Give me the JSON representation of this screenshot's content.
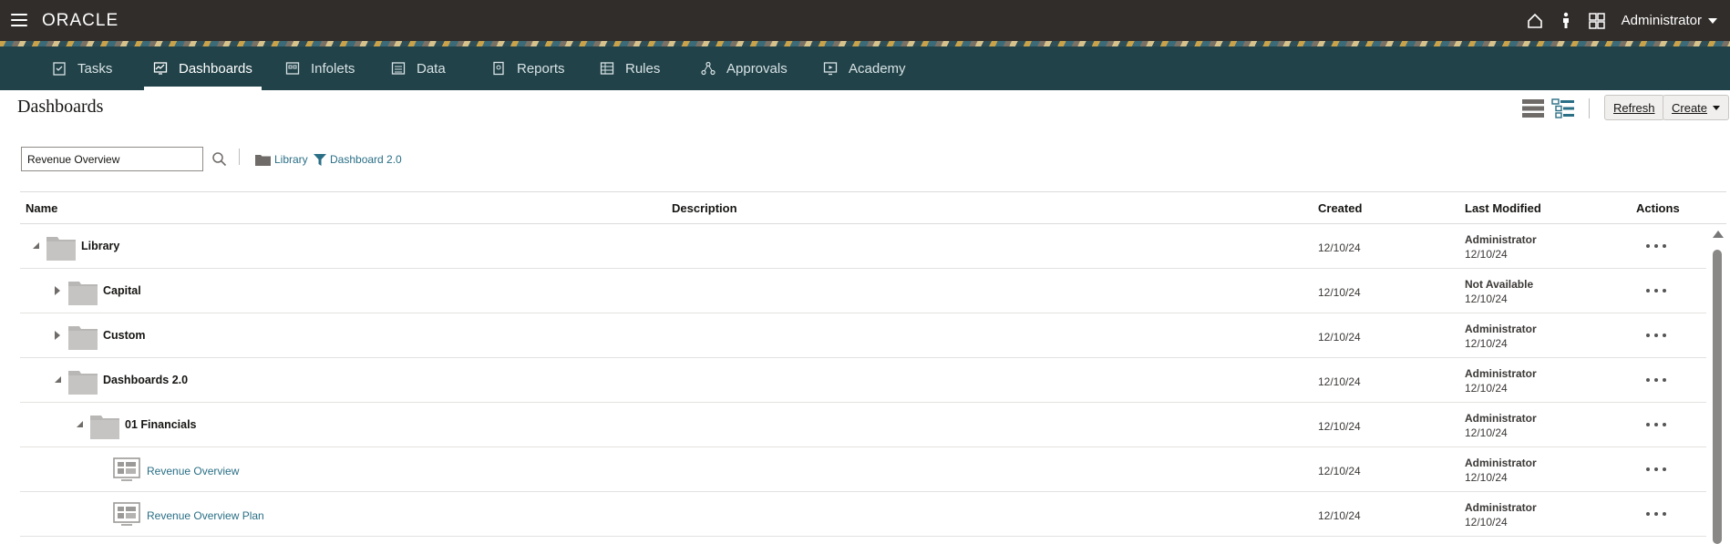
{
  "topbar": {
    "brand": "ORACLE",
    "user_label": "Administrator",
    "icons": [
      "home-icon",
      "accessibility-icon",
      "app-grid-icon"
    ]
  },
  "nav": {
    "items": [
      {
        "label": "Tasks",
        "icon": "tasks-icon",
        "active": false
      },
      {
        "label": "Dashboards",
        "icon": "dashboards-icon",
        "active": true
      },
      {
        "label": "Infolets",
        "icon": "infolets-icon",
        "active": false
      },
      {
        "label": "Data",
        "icon": "data-icon",
        "active": false
      },
      {
        "label": "Reports",
        "icon": "reports-icon",
        "active": false
      },
      {
        "label": "Rules",
        "icon": "rules-icon",
        "active": false
      },
      {
        "label": "Approvals",
        "icon": "approvals-icon",
        "active": false
      },
      {
        "label": "Academy",
        "icon": "academy-icon",
        "active": false
      }
    ]
  },
  "page": {
    "title": "Dashboards",
    "refresh_label": "Refresh",
    "create_label": "Create"
  },
  "filter": {
    "search_value": "Revenue Overview",
    "crumbs": [
      {
        "label": "Library",
        "icon": "folder-icon"
      },
      {
        "label": "Dashboard 2.0",
        "icon": "filter-icon"
      }
    ]
  },
  "table": {
    "columns": [
      "Name",
      "Description",
      "Created",
      "Last Modified",
      "Actions"
    ],
    "rows": [
      {
        "name": "Library",
        "type": "folder",
        "level": 0,
        "expanded": true,
        "created": "12/10/24",
        "modified_by": "Administrator",
        "modified_date": "12/10/24"
      },
      {
        "name": "Capital",
        "type": "folder",
        "level": 1,
        "expanded": false,
        "created": "12/10/24",
        "modified_by": "Not Available",
        "modified_date": "12/10/24"
      },
      {
        "name": "Custom",
        "type": "folder",
        "level": 1,
        "expanded": false,
        "created": "12/10/24",
        "modified_by": "Administrator",
        "modified_date": "12/10/24"
      },
      {
        "name": "Dashboards 2.0",
        "type": "folder",
        "level": 1,
        "expanded": true,
        "created": "12/10/24",
        "modified_by": "Administrator",
        "modified_date": "12/10/24"
      },
      {
        "name": "01 Financials",
        "type": "folder",
        "level": 2,
        "expanded": true,
        "created": "12/10/24",
        "modified_by": "Administrator",
        "modified_date": "12/10/24"
      },
      {
        "name": "Revenue Overview",
        "type": "dashboard",
        "level": 3,
        "created": "12/10/24",
        "modified_by": "Administrator",
        "modified_date": "12/10/24"
      },
      {
        "name": "Revenue Overview Plan",
        "type": "dashboard",
        "level": 3,
        "created": "12/10/24",
        "modified_by": "Administrator",
        "modified_date": "12/10/24"
      }
    ]
  },
  "colors": {
    "topbar": "#312d2a",
    "navbar": "#214248",
    "link": "#2a6f86"
  }
}
